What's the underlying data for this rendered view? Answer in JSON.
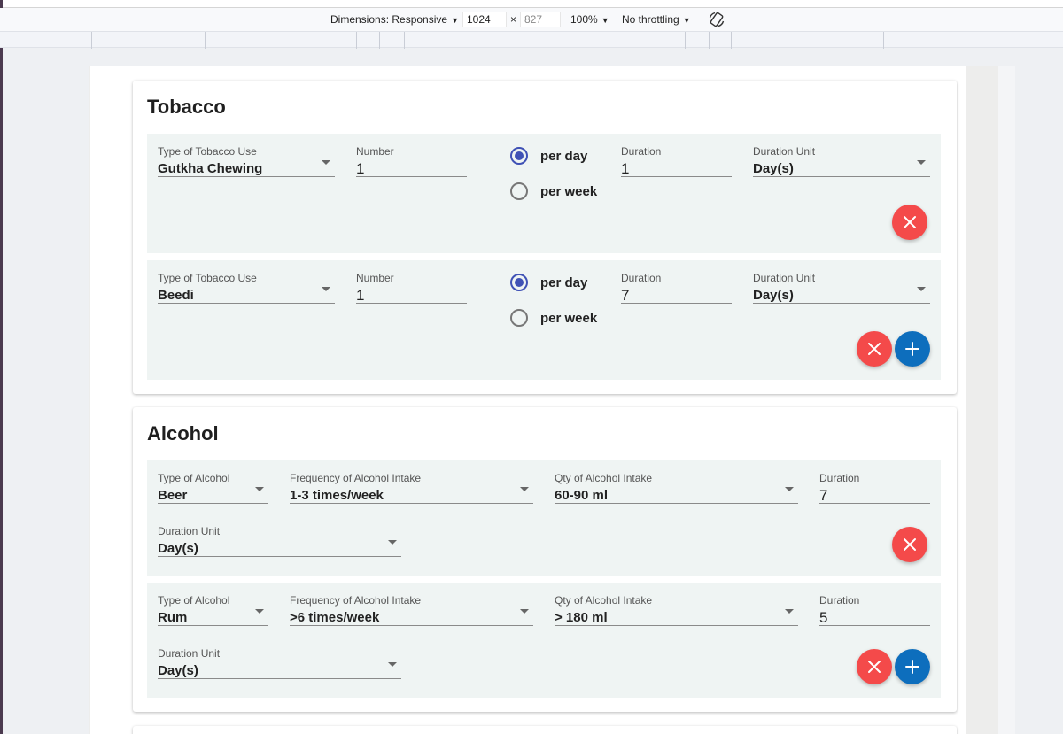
{
  "devtools": {
    "dimensions_label": "Dimensions: Responsive",
    "width": "1024",
    "times": "×",
    "height": "827",
    "zoom": "100%",
    "throttling": "No throttling"
  },
  "tobacco": {
    "title": "Tobacco",
    "entries": [
      {
        "type_label": "Type of Tobacco Use",
        "type_value": "Gutkha Chewing",
        "number_label": "Number",
        "number_value": "1",
        "per_day": "per day",
        "per_week": "per week",
        "frequency_selected": "per day",
        "duration_label": "Duration",
        "duration_value": "1",
        "unit_label": "Duration Unit",
        "unit_value": "Day(s)",
        "actions": [
          "remove"
        ]
      },
      {
        "type_label": "Type of Tobacco Use",
        "type_value": "Beedi",
        "number_label": "Number",
        "number_value": "1",
        "per_day": "per day",
        "per_week": "per week",
        "frequency_selected": "per day",
        "duration_label": "Duration",
        "duration_value": "7",
        "unit_label": "Duration Unit",
        "unit_value": "Day(s)",
        "actions": [
          "remove",
          "add"
        ]
      }
    ]
  },
  "alcohol": {
    "title": "Alcohol",
    "entries": [
      {
        "type_label": "Type of Alcohol",
        "type_value": "Beer",
        "freq_label": "Frequency of Alcohol Intake",
        "freq_value": "1-3 times/week",
        "qty_label": "Qty of Alcohol Intake",
        "qty_value": "60-90 ml",
        "duration_label": "Duration",
        "duration_value": "7",
        "unit_label": "Duration Unit",
        "unit_value": "Day(s)",
        "actions": [
          "remove"
        ]
      },
      {
        "type_label": "Type of Alcohol",
        "type_value": "Rum",
        "freq_label": "Frequency of Alcohol Intake",
        "freq_value": ">6 times/week",
        "qty_label": "Qty of Alcohol Intake",
        "qty_value": "> 180 ml",
        "duration_label": "Duration",
        "duration_value": "5",
        "unit_label": "Duration Unit",
        "unit_value": "Day(s)",
        "actions": [
          "remove",
          "add"
        ]
      }
    ]
  },
  "colors": {
    "remove": "#f44a4a",
    "add": "#0d6ebd",
    "radio": "#3f51b5",
    "row_bg": "#eff4f3"
  },
  "icons": {
    "remove": "close-icon",
    "add": "plus-icon",
    "rotate": "rotate-icon",
    "dropdown": "dropdown-arrow-icon"
  }
}
